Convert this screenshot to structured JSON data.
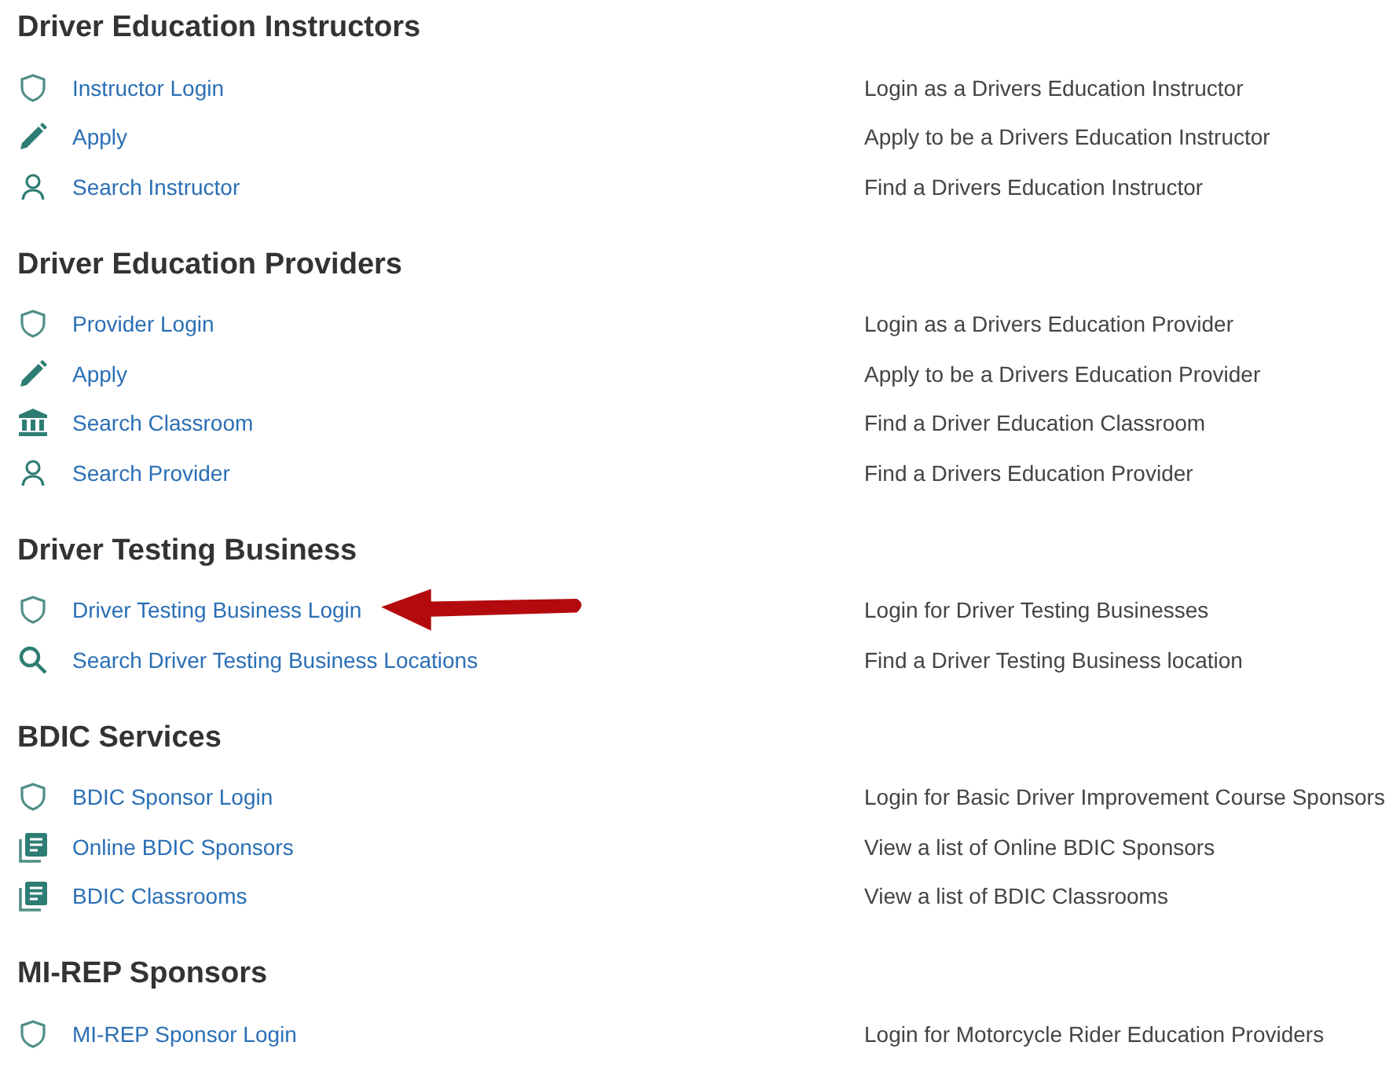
{
  "sections": [
    {
      "title": "Driver Education Instructors",
      "items": [
        {
          "kind": "shield",
          "label": "Instructor Login",
          "description": "Login as a Drivers Education Instructor",
          "pointer": false
        },
        {
          "kind": "pencil",
          "label": "Apply",
          "description": "Apply to be a Drivers Education Instructor",
          "pointer": false
        },
        {
          "kind": "person",
          "label": "Search Instructor",
          "description": "Find a Drivers Education Instructor",
          "pointer": false
        }
      ]
    },
    {
      "title": "Driver Education Providers",
      "items": [
        {
          "kind": "shield",
          "label": "Provider Login",
          "description": "Login as a Drivers Education Provider",
          "pointer": false
        },
        {
          "kind": "pencil",
          "label": "Apply",
          "description": "Apply to be a Drivers Education Provider",
          "pointer": false
        },
        {
          "kind": "building",
          "label": "Search Classroom",
          "description": "Find a Driver Education Classroom",
          "pointer": false
        },
        {
          "kind": "person",
          "label": "Search Provider",
          "description": "Find a Drivers Education Provider",
          "pointer": false
        }
      ]
    },
    {
      "title": "Driver Testing Business",
      "items": [
        {
          "kind": "shield",
          "label": "Driver Testing Business Login",
          "description": "Login for Driver Testing Businesses",
          "pointer": true
        },
        {
          "kind": "search",
          "label": "Search Driver Testing Business Locations",
          "description": "Find a Driver Testing Business location",
          "pointer": false
        }
      ]
    },
    {
      "title": "BDIC Services",
      "items": [
        {
          "kind": "shield",
          "label": "BDIC Sponsor Login",
          "description": "Login for Basic Driver Improvement Course Sponsors",
          "pointer": false
        },
        {
          "kind": "list",
          "label": "Online BDIC Sponsors",
          "description": "View a list of Online BDIC Sponsors",
          "pointer": false
        },
        {
          "kind": "list",
          "label": "BDIC Classrooms",
          "description": "View a list of BDIC Classrooms",
          "pointer": false
        }
      ]
    },
    {
      "title": "MI-REP Sponsors",
      "items": [
        {
          "kind": "shield",
          "label": "MI-REP Sponsor Login",
          "description": "Login for Motorcycle Rider Education Providers",
          "pointer": false
        }
      ]
    }
  ]
}
